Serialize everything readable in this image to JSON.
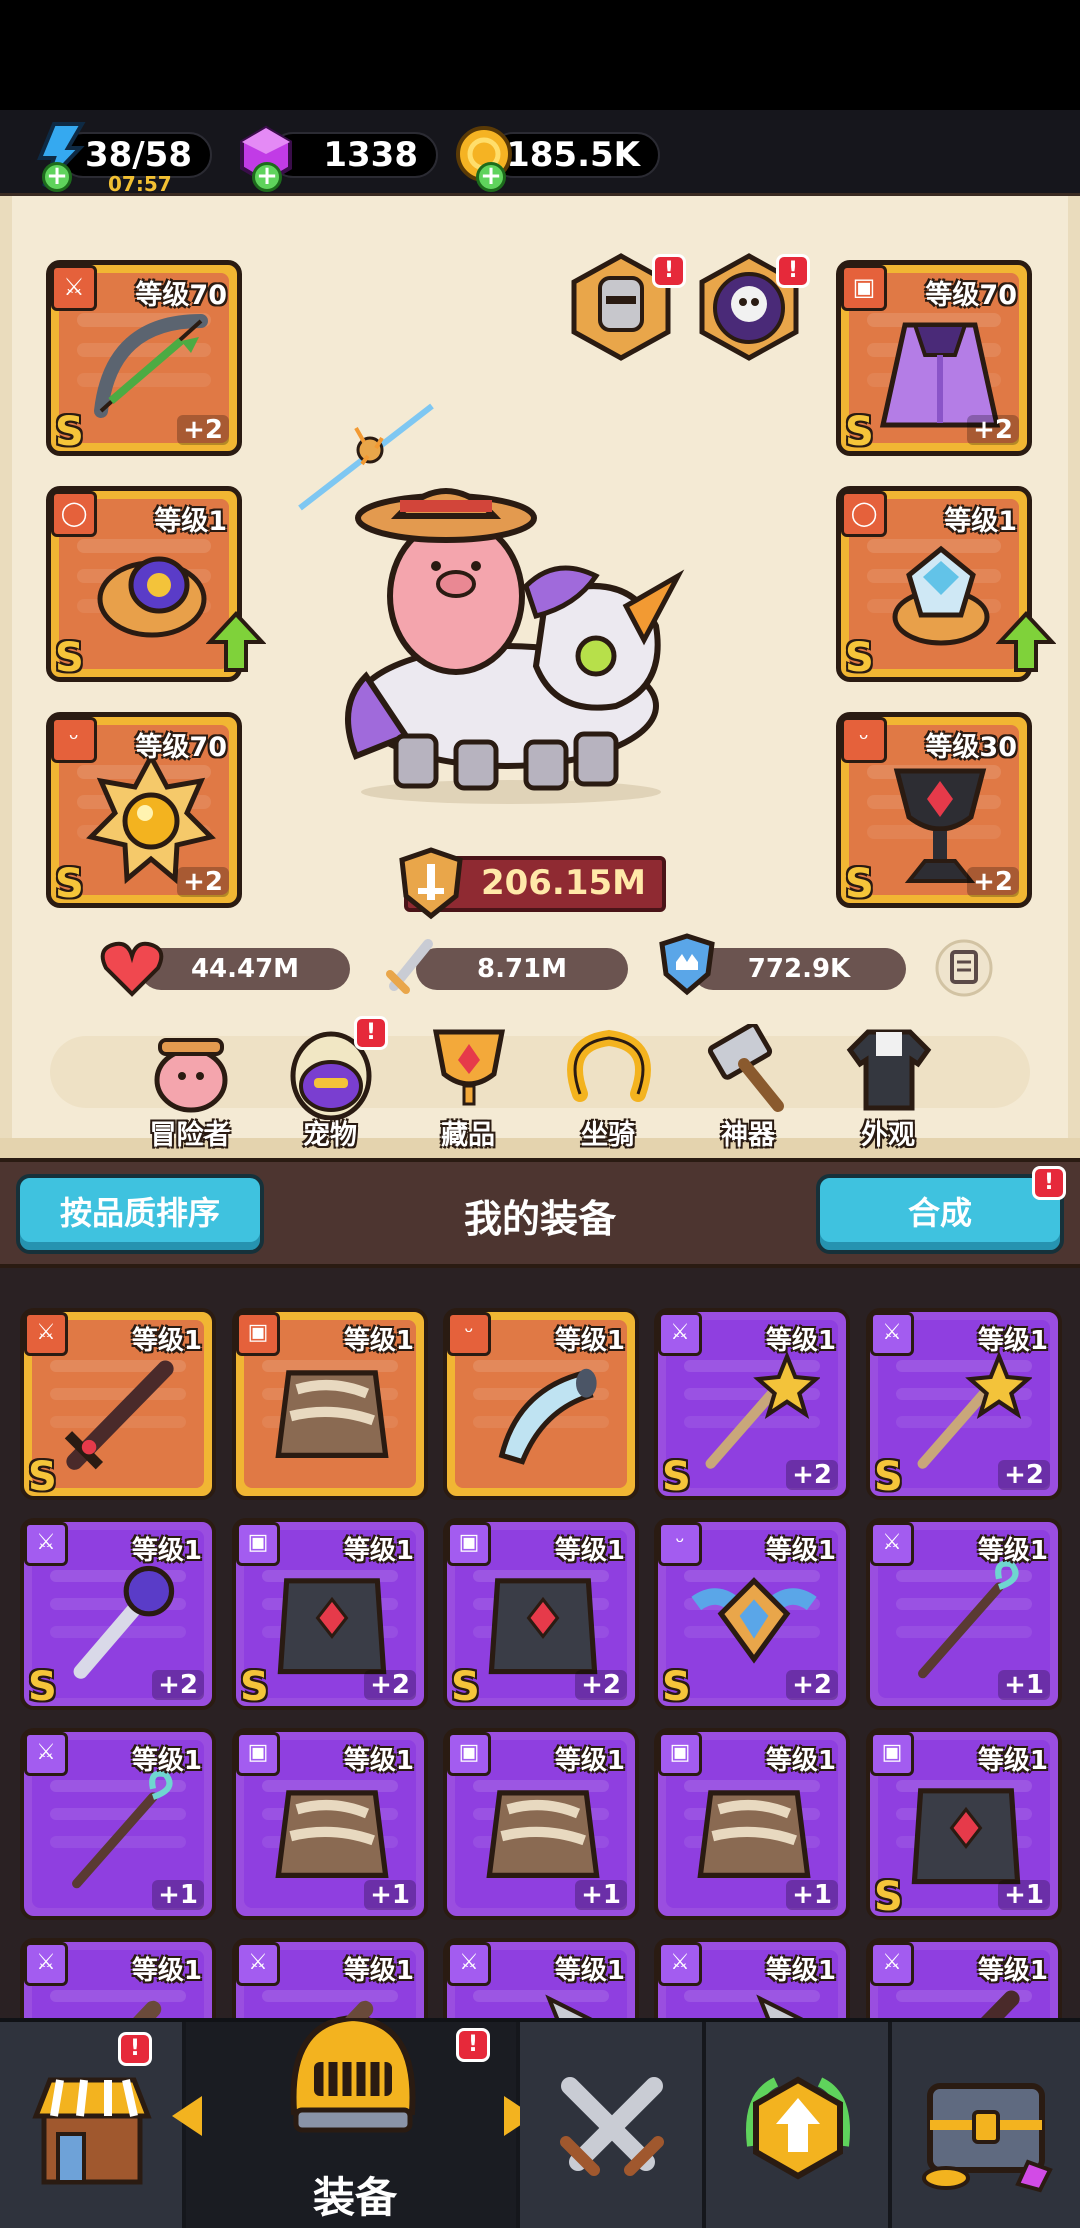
{
  "resources": {
    "energy": "38/58",
    "energy_timer": "07:57",
    "gems": "1338",
    "gold": "185.5K"
  },
  "equipped": {
    "left": [
      {
        "level": "等级70",
        "grade": "S",
        "plus": "+2",
        "icon": "bow-icon",
        "slot_icon": "sword-slot-icon"
      },
      {
        "level": "等级1",
        "grade": "S",
        "icon": "ring-icon",
        "slot_icon": "ring-slot-icon",
        "upgrade": true
      },
      {
        "level": "等级70",
        "grade": "S",
        "plus": "+2",
        "icon": "amulet-icon",
        "slot_icon": "necklace-slot-icon"
      }
    ],
    "right": [
      {
        "level": "等级70",
        "grade": "S",
        "plus": "+2",
        "icon": "cape-icon",
        "slot_icon": "armor-slot-icon"
      },
      {
        "level": "等级1",
        "grade": "S",
        "icon": "gem-ring-icon",
        "slot_icon": "ring-slot-icon",
        "upgrade": true
      },
      {
        "level": "等级30",
        "grade": "S",
        "plus": "+2",
        "icon": "chalice-icon",
        "slot_icon": "necklace-slot-icon"
      }
    ]
  },
  "hero": {
    "power": "206.15M",
    "hp": "44.47M",
    "attack": "8.71M",
    "defense": "772.9K"
  },
  "menu": [
    {
      "label": "冒险者",
      "icon": "adventurer-icon"
    },
    {
      "label": "宠物",
      "icon": "pet-icon",
      "badge": "!"
    },
    {
      "label": "藏品",
      "icon": "collection-icon"
    },
    {
      "label": "坐骑",
      "icon": "mount-icon"
    },
    {
      "label": "神器",
      "icon": "artifact-icon"
    },
    {
      "label": "外观",
      "icon": "appearance-icon"
    }
  ],
  "inventory": {
    "sort_label": "按品质排序",
    "title": "我的装备",
    "merge_label": "合成",
    "items": [
      {
        "level": "等级1",
        "grade": "S",
        "rarity": "orange",
        "icon": "sword-icon",
        "slot_icon": "sword-slot-icon"
      },
      {
        "level": "等级1",
        "rarity": "orange",
        "icon": "fur-armor-icon",
        "slot_icon": "armor-slot-icon"
      },
      {
        "level": "等级1",
        "rarity": "orange",
        "icon": "horn-icon",
        "slot_icon": "necklace-slot-icon"
      },
      {
        "level": "等级1",
        "grade": "S",
        "plus": "+2",
        "rarity": "purple",
        "icon": "star-wand-icon",
        "slot_icon": "sword-slot-icon"
      },
      {
        "level": "等级1",
        "grade": "S",
        "plus": "+2",
        "rarity": "purple",
        "icon": "star-wand-icon",
        "slot_icon": "sword-slot-icon"
      },
      {
        "level": "等级1",
        "grade": "S",
        "plus": "+2",
        "rarity": "purple",
        "icon": "orb-staff-icon",
        "slot_icon": "sword-slot-icon"
      },
      {
        "level": "等级1",
        "grade": "S",
        "plus": "+2",
        "rarity": "purple",
        "icon": "dark-armor-icon",
        "slot_icon": "armor-slot-icon"
      },
      {
        "level": "等级1",
        "grade": "S",
        "plus": "+2",
        "rarity": "purple",
        "icon": "dark-armor-icon",
        "slot_icon": "armor-slot-icon"
      },
      {
        "level": "等级1",
        "grade": "S",
        "plus": "+2",
        "rarity": "purple",
        "icon": "winged-emblem-icon",
        "slot_icon": "necklace-slot-icon"
      },
      {
        "level": "等级1",
        "plus": "+1",
        "rarity": "purple",
        "icon": "spiral-staff-icon",
        "slot_icon": "sword-slot-icon"
      },
      {
        "level": "等级1",
        "plus": "+1",
        "rarity": "purple",
        "icon": "spiral-staff-icon",
        "slot_icon": "sword-slot-icon"
      },
      {
        "level": "等级1",
        "plus": "+1",
        "rarity": "purple",
        "icon": "fur-armor-icon",
        "slot_icon": "armor-slot-icon"
      },
      {
        "level": "等级1",
        "plus": "+1",
        "rarity": "purple",
        "icon": "fur-armor-icon",
        "slot_icon": "armor-slot-icon"
      },
      {
        "level": "等级1",
        "plus": "+1",
        "rarity": "purple",
        "icon": "fur-armor-icon",
        "slot_icon": "armor-slot-icon"
      },
      {
        "level": "等级1",
        "grade": "S",
        "plus": "+1",
        "rarity": "purple",
        "icon": "dark-armor-icon",
        "slot_icon": "armor-slot-icon"
      },
      {
        "level": "等级1",
        "rarity": "purple",
        "icon": "club-icon",
        "slot_icon": "sword-slot-icon"
      },
      {
        "level": "等级1",
        "rarity": "purple",
        "icon": "club-icon",
        "slot_icon": "sword-slot-icon"
      },
      {
        "level": "等级1",
        "rarity": "purple",
        "icon": "axe-icon",
        "slot_icon": "sword-slot-icon"
      },
      {
        "level": "等级1",
        "rarity": "purple",
        "icon": "axe-icon",
        "slot_icon": "sword-slot-icon"
      },
      {
        "level": "等级1",
        "rarity": "purple",
        "icon": "sword-icon",
        "slot_icon": "sword-slot-icon"
      }
    ]
  },
  "nav": {
    "active_label": "装备",
    "tabs": [
      {
        "icon": "shop-icon",
        "badge": "!"
      },
      {
        "icon": "helmet-icon",
        "badge": "!"
      },
      {
        "icon": "crossed-swords-icon"
      },
      {
        "icon": "upgrade-icon"
      },
      {
        "icon": "treasure-chest-icon"
      }
    ]
  },
  "colors": {
    "orange_tier": "#e07945",
    "purple_tier": "#8f3fe0",
    "accent_cyan": "#3fc2df",
    "badge_red": "#e6293a"
  }
}
